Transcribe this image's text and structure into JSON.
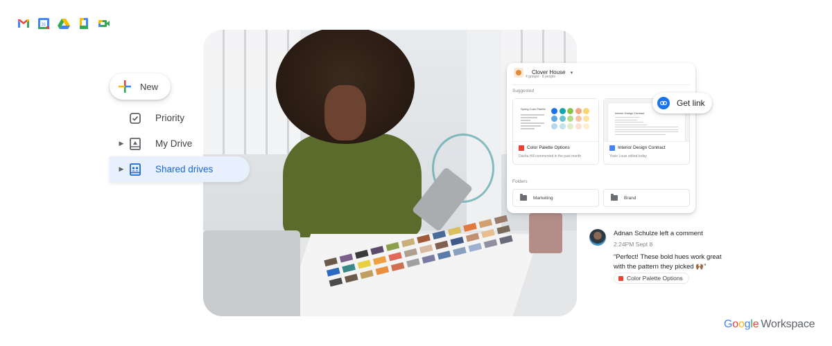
{
  "apps": [
    {
      "name": "Gmail",
      "icon": "gmail-icon"
    },
    {
      "name": "Calendar",
      "icon": "calendar-icon",
      "label": "31"
    },
    {
      "name": "Drive",
      "icon": "drive-icon"
    },
    {
      "name": "Docs",
      "icon": "docs-icon"
    },
    {
      "name": "Meet",
      "icon": "meet-icon"
    }
  ],
  "sidebar": {
    "new_label": "New",
    "items": [
      {
        "label": "Priority",
        "icon": "priority-checkbox-icon",
        "active": false,
        "expandable": false
      },
      {
        "label": "My Drive",
        "icon": "my-drive-icon",
        "active": false,
        "expandable": true
      },
      {
        "label": "Shared drives",
        "icon": "shared-drives-icon",
        "active": true,
        "expandable": true
      }
    ]
  },
  "drive_card": {
    "title": "Clover House",
    "subtitle": "4 groups · 8 people",
    "suggested_label": "Suggested",
    "files": [
      {
        "name": "Color Palette Options",
        "type": "pdf",
        "meta": "Dasha Hill commented in the past month",
        "preview_title": "Spring Color Palette"
      },
      {
        "name": "Interior Design Contract",
        "type": "doc",
        "meta": "Yosie Louis edited today",
        "preview_title": "Interior Design Contract"
      }
    ],
    "folders_label": "Folders",
    "folders": [
      "Marketing",
      "Brand"
    ],
    "palette_colors": [
      "#1a73e8",
      "#12a4af",
      "#8bc34a",
      "#f4a582",
      "#f9d56e",
      "#5fa8e0",
      "#6cc3cf",
      "#b6d98a",
      "#f6c3a6",
      "#fbe3a3",
      "#b4d7f2",
      "#bfe5ea",
      "#dcedc8",
      "#fbe0d2",
      "#fdf0cf"
    ]
  },
  "get_link": {
    "label": "Get link"
  },
  "comment": {
    "author_line": "Adnan Schulze left a comment",
    "time": "2:24PM Sept 8",
    "text": "“Perfect! These bold hues work great with the pattern they picked 🙌🏾”",
    "attachment": "Color Palette Options"
  },
  "brand": {
    "google": [
      "G",
      "o",
      "o",
      "g",
      "l",
      "e"
    ],
    "product": "Workspace"
  },
  "colors": {
    "blue": "#4285f4",
    "red": "#ea4335",
    "yellow": "#fbbc04",
    "green": "#34a853",
    "active_bg": "#e8f0fe",
    "active_text": "#1967d2"
  }
}
